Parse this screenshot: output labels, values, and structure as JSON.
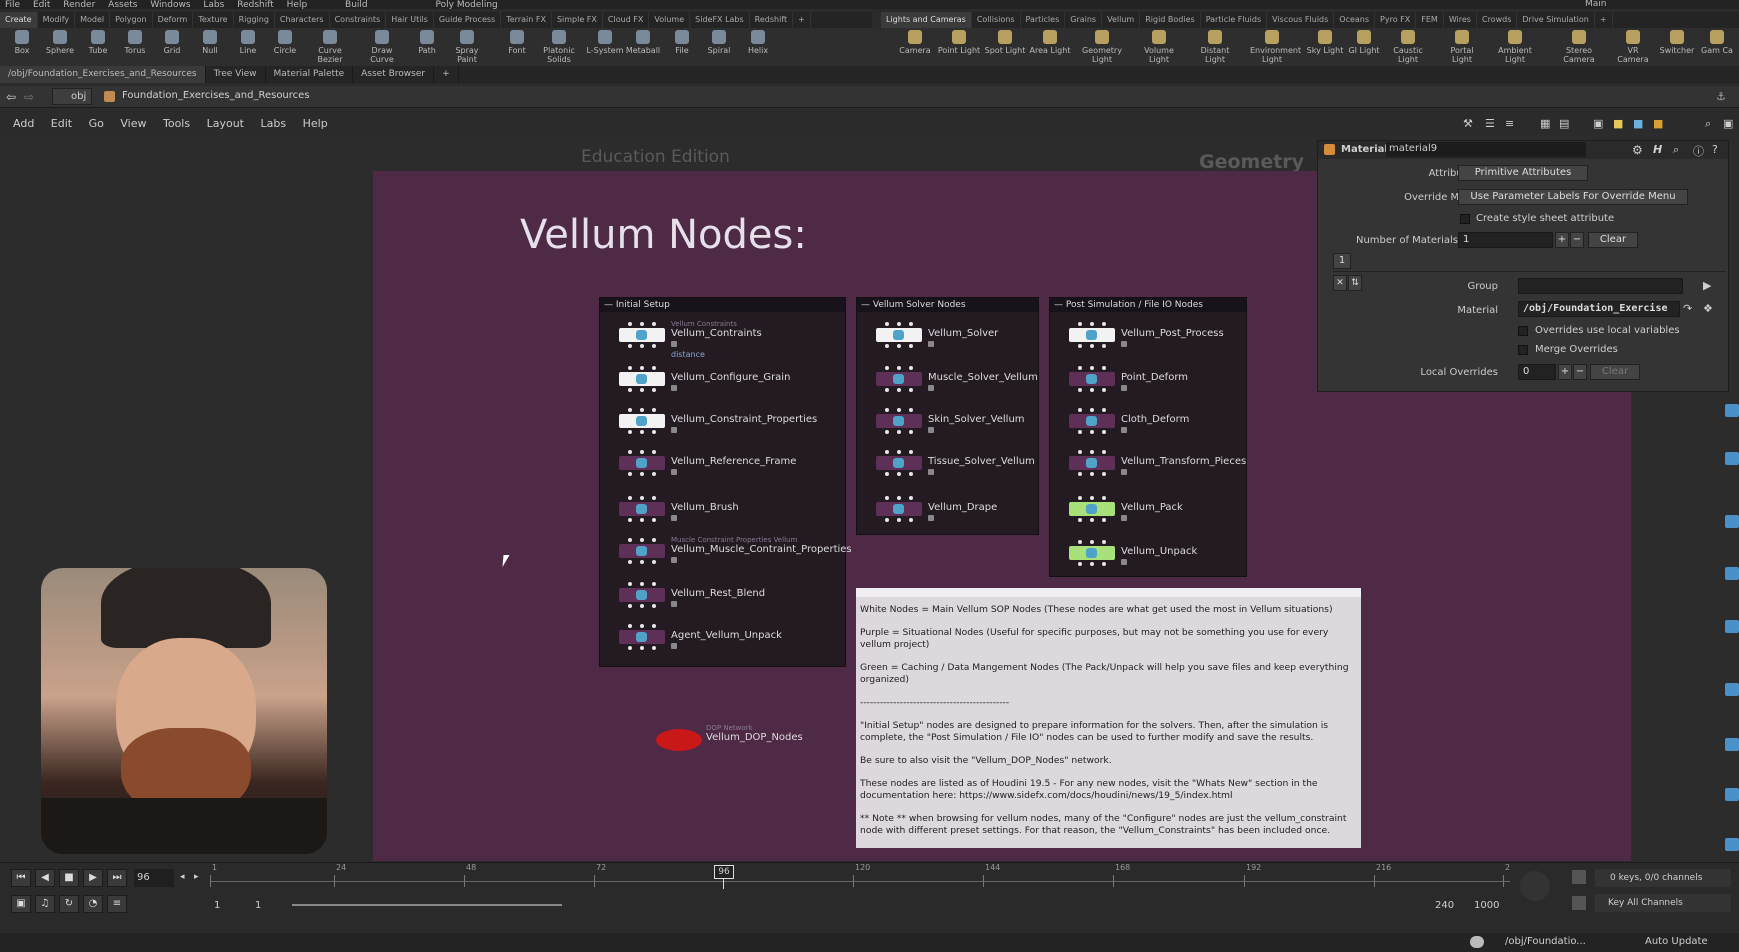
{
  "menubar": [
    "File",
    "Edit",
    "Render",
    "Assets",
    "Windows",
    "Labs",
    "Redshift",
    "Help",
    "Build",
    "Poly Modeling",
    "Main"
  ],
  "shelf_tabs_left": [
    "Create",
    "Modify",
    "Model",
    "Polygon",
    "Deform",
    "Texture",
    "Rigging",
    "Characters",
    "Constraints",
    "Hair Utils",
    "Guide Process",
    "Terrain FX",
    "Simple FX",
    "Cloud FX",
    "Volume",
    "SideFX Labs",
    "Redshift"
  ],
  "shelf_tabs_right": [
    "Lights and Cameras",
    "Collisions",
    "Particles",
    "Grains",
    "Vellum",
    "Rigid Bodies",
    "Particle Fluids",
    "Viscous Fluids",
    "Oceans",
    "Pyro FX",
    "FEM",
    "Wires",
    "Crowds",
    "Drive Simulation"
  ],
  "tools_left": [
    "Box",
    "Sphere",
    "Tube",
    "Torus",
    "Grid",
    "Null",
    "Line",
    "Circle",
    "Curve Bezier",
    "Draw Curve",
    "Path",
    "Spray Paint",
    "Font",
    "Platonic Solids",
    "L-System",
    "Metaball",
    "File",
    "Spiral",
    "Helix"
  ],
  "tools_right": [
    "Camera",
    "Point Light",
    "Spot Light",
    "Area Light",
    "Geometry Light",
    "Volume Light",
    "Distant Light",
    "Environment Light",
    "Sky Light",
    "GI Light",
    "Caustic Light",
    "Portal Light",
    "Ambient Light",
    "Stereo Camera",
    "VR Camera",
    "Switcher",
    "Gam Ca"
  ],
  "pane_tabs": [
    "/obj/Foundation_Exercises_and_Resources",
    "Tree View",
    "Material Palette",
    "Asset Browser"
  ],
  "path": {
    "root": "obj",
    "current": "Foundation_Exercises_and_Resources"
  },
  "net_menu": [
    "Add",
    "Edit",
    "Go",
    "View",
    "Tools",
    "Layout",
    "Labs",
    "Help"
  ],
  "watermark_left": "Education Edition",
  "watermark_right": "Geometry",
  "title": "Vellum Nodes:",
  "boxes": {
    "initial": {
      "header": "Initial Setup",
      "nodes": [
        {
          "label": "Vellum_Contraints",
          "sub": "Vellum Constraints",
          "extra": "distance",
          "color": "white"
        },
        {
          "label": "Vellum_Configure_Grain",
          "color": "white"
        },
        {
          "label": "Vellum_Constraint_Properties",
          "color": "white"
        },
        {
          "label": "Vellum_Reference_Frame",
          "color": "purple"
        },
        {
          "label": "Vellum_Brush",
          "color": "purple"
        },
        {
          "label": "Vellum_Muscle_Contraint_Properties",
          "sub": "Muscle Constraint Properties Vellum",
          "color": "purple"
        },
        {
          "label": "Vellum_Rest_Blend",
          "color": "purple"
        },
        {
          "label": "Agent_Vellum_Unpack",
          "color": "purple"
        }
      ]
    },
    "solver": {
      "header": "Vellum Solver Nodes",
      "nodes": [
        {
          "label": "Vellum_Solver",
          "color": "white"
        },
        {
          "label": "Muscle_Solver_Vellum",
          "color": "purple"
        },
        {
          "label": "Skin_Solver_Vellum",
          "color": "purple"
        },
        {
          "label": "Tissue_Solver_Vellum",
          "color": "purple"
        },
        {
          "label": "Vellum_Drape",
          "color": "purple"
        }
      ]
    },
    "post": {
      "header": "Post Simulation / File IO Nodes",
      "nodes": [
        {
          "label": "Vellum_Post_Process",
          "color": "white"
        },
        {
          "label": "Point_Deform",
          "color": "purple"
        },
        {
          "label": "Cloth_Deform",
          "color": "purple"
        },
        {
          "label": "Vellum_Transform_Pieces",
          "color": "purple"
        },
        {
          "label": "Vellum_Pack",
          "color": "green"
        },
        {
          "label": "Vellum_Unpack",
          "color": "green"
        }
      ]
    }
  },
  "dop_node": {
    "sub": "DOP Network",
    "label": "Vellum_DOP_Nodes"
  },
  "notes": [
    "White Nodes = Main Vellum SOP Nodes (These nodes are what get used the most in Vellum situations)",
    "Purple = Situational Nodes (Useful for specific purposes, but may not be something you use for every vellum project)",
    "Green = Caching / Data Mangement Nodes (The Pack/Unpack will help you save files and keep everything organized)",
    "---------------------------------------------",
    "\"Initial Setup\" nodes are designed to prepare information for the solvers.  Then, after the simulation is complete, the \"Post Simulation / File IO\" nodes can be used to further modify and save the results.",
    "Be sure to also visit the \"Vellum_DOP_Nodes\" network.",
    "These nodes are listed as of Houdini 19.5 - For any new nodes, visit the \"Whats New\" section in the documentation here:  https://www.sidefx.com/docs/houdini/news/19_5/index.html",
    "** Note ** when browsing for vellum nodes, many of the \"Configure\" nodes are just the vellum_constraint node with different preset settings.  For that reason, the \"Vellum_Constraints\" has been included once."
  ],
  "params": {
    "node_type": "Material",
    "node_name": "material9",
    "attributes_label": "Attributes",
    "attributes_value": "Primitive Attributes",
    "override_menu_label": "Override Menu",
    "override_menu_value": "Use Parameter Labels For Override Menu",
    "style_sheet_label": "Create style sheet attribute",
    "num_materials_label": "Number of Materials",
    "num_materials_value": "1",
    "clear_label": "Clear",
    "tab_index": "1",
    "group_label": "Group",
    "group_value": "",
    "material_label": "Material",
    "material_value": "/obj/Foundation_Exercise",
    "overrides_local_label": "Overrides use local variables",
    "merge_overrides_label": "Merge Overrides",
    "local_overrides_label": "Local Overrides",
    "local_overrides_value": "0",
    "clear2_label": "Clear"
  },
  "timeline": {
    "current_frame": "96",
    "frame_marker": "96",
    "ticks": [
      "1",
      "24",
      "48",
      "72",
      "120",
      "144",
      "168",
      "192",
      "216",
      "2"
    ],
    "start_a": "1",
    "start_b": "1",
    "end_a": "240",
    "end_b": "1000",
    "keys_info": "0 keys, 0/0 channels",
    "key_all_label": "Key All Channels",
    "status_path": "/obj/Foundatio...",
    "auto_update": "Auto Update"
  }
}
